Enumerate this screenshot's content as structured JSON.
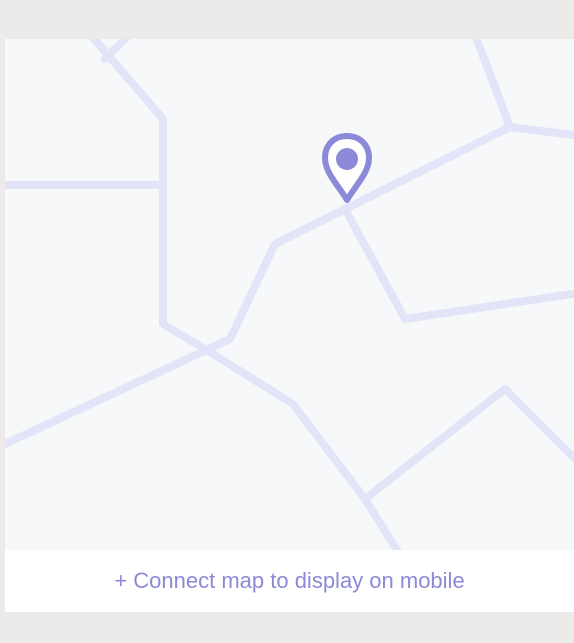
{
  "map": {
    "pin_icon": "location-pin-icon",
    "road_color": "#e2e4f8",
    "pin_color": "#8c8ad8",
    "background_color": "#f7f8fa"
  },
  "footer": {
    "connect_label": "+ Connect map to display on mobile",
    "link_color": "#8c8ad8"
  }
}
